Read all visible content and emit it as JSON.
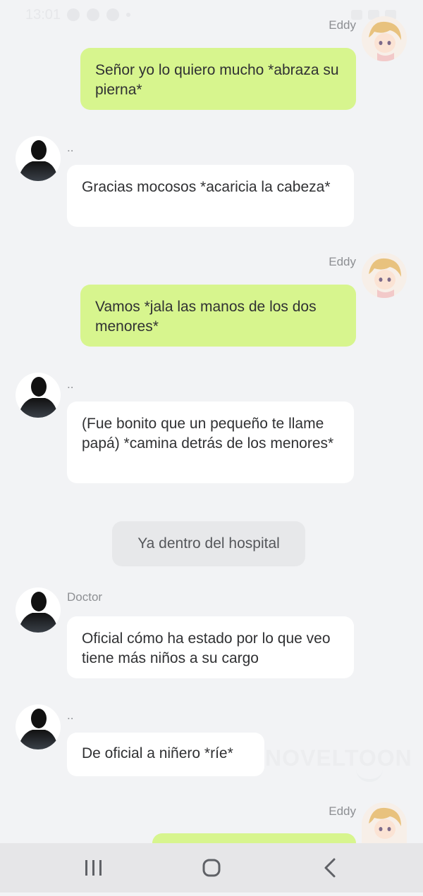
{
  "status_bar": {
    "time": "13:01"
  },
  "messages": [
    {
      "sender": "Eddy",
      "side": "out",
      "text": "Señor yo lo quiero mucho *abraza su pierna*"
    },
    {
      "sender": "..",
      "side": "in",
      "text": "Gracias mocosos *acaricia la cabeza*"
    },
    {
      "sender": "Eddy",
      "side": "out",
      "text": "Vamos *jala las manos de los dos menores*"
    },
    {
      "sender": "..",
      "side": "in",
      "text": "(Fue bonito que un pequeño te llame papá) *camina detrás de los menores*"
    },
    {
      "sender": "",
      "side": "narration",
      "text": "Ya dentro del hospital"
    },
    {
      "sender": "Doctor",
      "side": "in",
      "text": "Oficial cómo ha estado por lo que veo tiene más niños a su cargo"
    },
    {
      "sender": "..",
      "side": "in",
      "text": "De oficial a niñero *ríe*"
    },
    {
      "sender": "Eddy",
      "side": "out",
      "text": ""
    }
  ],
  "watermark": {
    "text": "NOVELTOON"
  },
  "nav_bar": {
    "buttons": [
      "recent-apps",
      "home",
      "back"
    ]
  },
  "colors": {
    "background": "#f2f3f5",
    "outgoing_bubble": "#d7f58e",
    "incoming_bubble": "#ffffff",
    "narration_bubble": "#e7e8ea"
  }
}
